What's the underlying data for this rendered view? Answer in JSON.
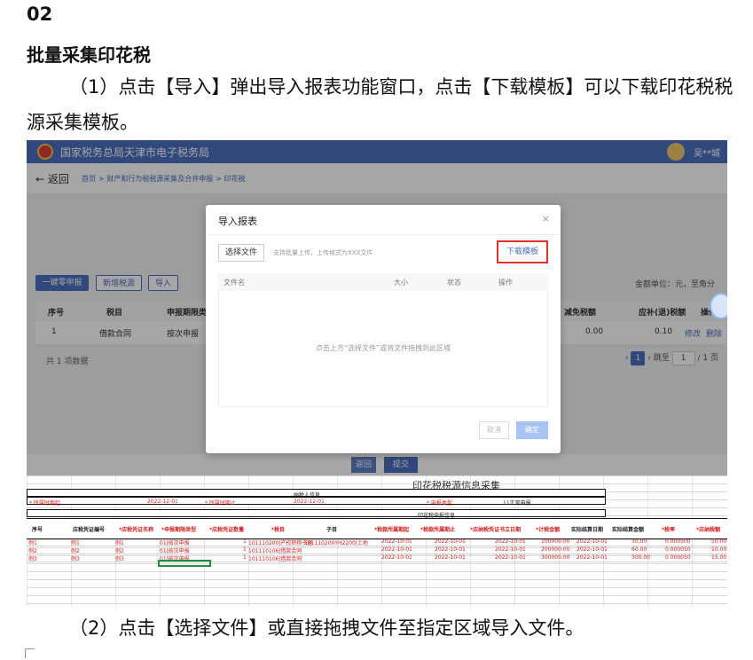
{
  "doc": {
    "section_number": "02",
    "title": "批量采集印花税",
    "para1": "（1）点击【导入】弹出导入报表功能窗口，点击【下载模板】可以下载印花税税源采集模板。",
    "para2": "（2）点击【选择文件】或直接拖拽文件至指定区域导入文件。"
  },
  "screenshot": {
    "site_title": "国家税务总局天津市电子税务局",
    "user_name": "吴**城",
    "back": "返回",
    "breadcrumb": [
      "首页",
      "财产和行为税税源采集及合并申报",
      "印花税"
    ],
    "toolbar": {
      "declare": "一键零申报",
      "add": "新增税源",
      "import": "导入"
    },
    "unit_text": "金额单位：元，至角分",
    "table": {
      "headers": [
        "序号",
        "税目",
        "申报期限类",
        "减免税额",
        "应补(退)税额",
        "操作"
      ],
      "row": {
        "no": "1",
        "item": "借款合同",
        "period": "按次申报",
        "relief": "0.00",
        "due": "0.10",
        "edit": "修改",
        "delete": "删除"
      }
    },
    "total": "共 1 项数据",
    "pager": {
      "page": "1",
      "goto": "跳至",
      "page_input": "1",
      "pages": "/ 1 页"
    },
    "bottom": {
      "back": "返回",
      "submit": "提交"
    },
    "modal": {
      "title": "导入报表",
      "close": "×",
      "choose": "选择文件",
      "hint": "支持批量上传，上传格式为XXX文件",
      "download": "下载模板",
      "headers": [
        "文件名",
        "大小",
        "状态",
        "操作"
      ],
      "drop_hint": "点击上方“选择文件”或将文件拖拽到此区域",
      "cancel": "取消",
      "ok": "确定"
    },
    "excel": {
      "title": "印花税税源信息采集",
      "taxpayer_section": "纳税人信息",
      "start_label": "* 所属时期起",
      "start_value": "2022-12-01",
      "end_label": "* 所属时期止",
      "end_value": "2022-12-01",
      "type_label": "* 申报类型",
      "type_value": "11正常申报",
      "detail_section": "印花税申报信息",
      "headers": [
        "序号",
        "应税凭证编号",
        "*应税凭证名称",
        "*申报期限类型",
        "*应税凭证数量",
        "*税目",
        "子目",
        "*税款所属期起",
        "*税款所属期止",
        "*应纳税凭证书立日期",
        "*计税金额",
        "实际结算日期",
        "实际结算金额",
        "*税率",
        "*应纳税额"
      ],
      "rows": [
        [
          "例1",
          "例1",
          "例1",
          "01|按次申报",
          "1",
          "101110200|产权转移书据",
          "101110200YH2200|土地",
          "2022-10-01",
          "2022-10-01",
          "2022-10-01",
          "100000.00",
          "2022-10-01",
          "30.00",
          "0.000500",
          "50.00"
        ],
        [
          "例2",
          "例2",
          "例2",
          "01|按次申报",
          "1",
          "101110106|借款合同",
          "",
          "2022-10-01",
          "2022-10-01",
          "2022-10-01",
          "200000.00",
          "2022-10-01",
          "60.00",
          "0.000050",
          "10.00"
        ],
        [
          "例3",
          "例3",
          "例3",
          "01|按次申报",
          "1",
          "101110106|借款合同",
          "",
          "2022-10-01",
          "2022-10-01",
          "2022-10-01",
          "300000.00",
          "2022-10-01",
          "300.00",
          "0.000050",
          "15.00"
        ]
      ]
    },
    "colors": {
      "brand": "#4a6fbf",
      "highlight": "#e0302a"
    }
  }
}
